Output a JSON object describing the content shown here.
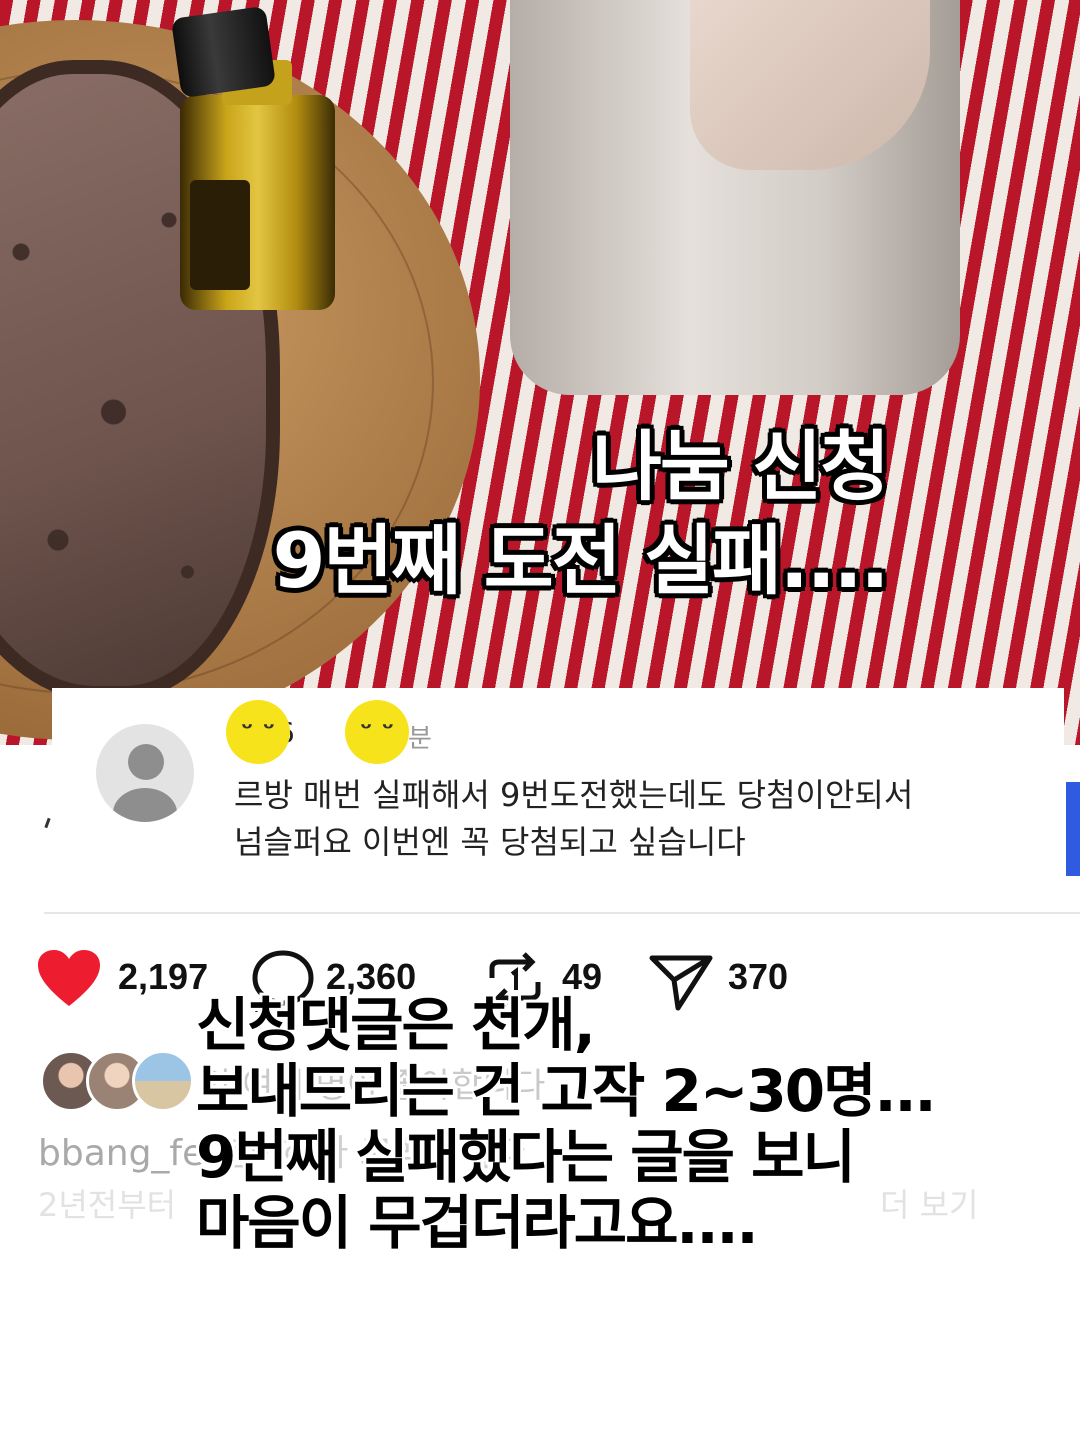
{
  "photo": {
    "caption_line1": "나눔 신청",
    "caption_line2": "9번째 도전 실패...."
  },
  "comment": {
    "username_visible": "ncj6",
    "time_suffix": "분",
    "text_line1": "르방 매번 실패해서 9번도전했는데도 당첨이안되서",
    "text_line2": "넘슬퍼요 이번엔 꼭 당첨되고 싶습니다",
    "sticker_icon": "smiley-sticker-icon"
  },
  "actions": {
    "likes": "2,197",
    "comments": "2,360",
    "reposts": "49",
    "shares": "370",
    "like_color": "#ed1c2e"
  },
  "background_rows": {
    "liked_by": "외 여러 명이 좋아합니다",
    "author": "bbang_fe",
    "author_caption": "년이하다 고백합니다",
    "faded_line": "2년전부터",
    "more": "더 보기"
  },
  "overlay": {
    "line1": "신청댓글은 천개,",
    "line2": "보내드리는 건 고작 2~30명...",
    "line3": "9번째 실패했다는 글을 보니",
    "line4": "마음이 무겁더라고요...."
  }
}
